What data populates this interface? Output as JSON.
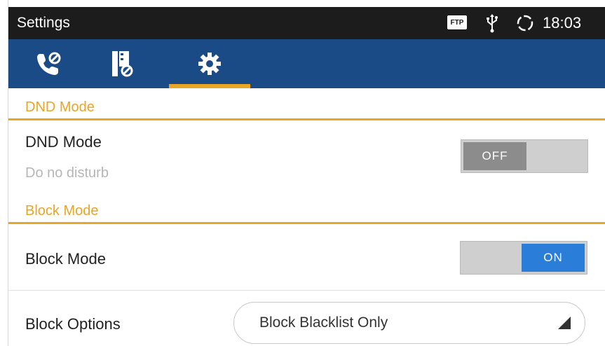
{
  "status_bar": {
    "title": "Settings",
    "ftp_label": "FTP",
    "time": "18:03"
  },
  "tabs": [
    {
      "icon": "call-settings-icon"
    },
    {
      "icon": "contacts-block-icon"
    },
    {
      "icon": "gear-icon",
      "selected": true
    }
  ],
  "sections": {
    "dnd_header": "DND Mode",
    "block_header": "Block Mode"
  },
  "dnd": {
    "title": "DND Mode",
    "subtitle": "Do no disturb",
    "toggle_label": "OFF",
    "enabled": false
  },
  "block": {
    "title": "Block Mode",
    "toggle_label": "ON",
    "enabled": true
  },
  "block_options": {
    "label": "Block Options",
    "value": "Block Blacklist Only"
  },
  "colors": {
    "accent": "#e9a524",
    "toolbar": "#1b4b86",
    "status_bar": "#1c1c1c",
    "toggle_on": "#2b7ed8",
    "toggle_off": "#8c8c8c"
  }
}
